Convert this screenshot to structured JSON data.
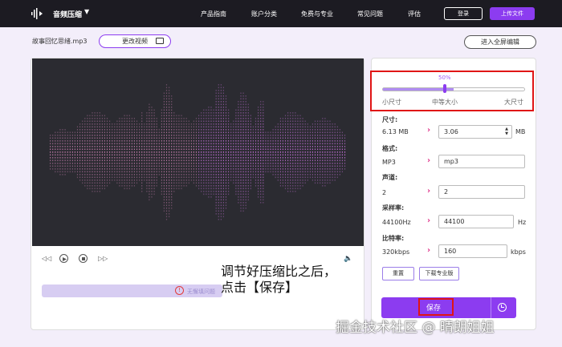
{
  "header": {
    "app_name": "音频压缩",
    "caret": "▼",
    "nav": [
      "产品指南",
      "账户分类",
      "免费与专业",
      "常见问题",
      "评估"
    ],
    "login": "登录",
    "upload": "上传文件"
  },
  "toolbar": {
    "file_name": "故事回忆思绪.mp3",
    "change_video": "更改视频",
    "fullscreen_edit": "进入全屏编辑"
  },
  "player": {
    "bar_text": "无懈填问题",
    "warn_symbol": "!"
  },
  "annotation": {
    "line1": "调节好压缩比之后，",
    "line2": "点击【保存】"
  },
  "compression": {
    "percent_label": "50%",
    "level": 0.5,
    "labels": [
      "小尺寸",
      "中等大小",
      "大尺寸"
    ]
  },
  "settings": {
    "size": {
      "label": "尺寸:",
      "original": "6.13 MB",
      "value": "3.06",
      "unit": "MB"
    },
    "format": {
      "label": "格式:",
      "original": "MP3",
      "value": "mp3"
    },
    "channels": {
      "label": "声道:",
      "original": "2",
      "value": "2"
    },
    "sample_rate": {
      "label": "采样率:",
      "original": "44100Hz",
      "value": "44100",
      "unit": "Hz"
    },
    "bitrate": {
      "label": "比特率:",
      "original": "320kbps",
      "value": "160",
      "unit": "kbps"
    },
    "arrow": "›"
  },
  "buttons": {
    "reset": "重置",
    "download_pro": "下载专业版",
    "save": "保存"
  },
  "watermark": "掘金技术社区 @ 晴朗姐姐",
  "colors": {
    "accent": "#8c3cf0",
    "highlight_box": "#e01515",
    "arrow": "#e0348b",
    "topbar": "#1c1b22",
    "waveform_bg": "#2b2b31"
  }
}
